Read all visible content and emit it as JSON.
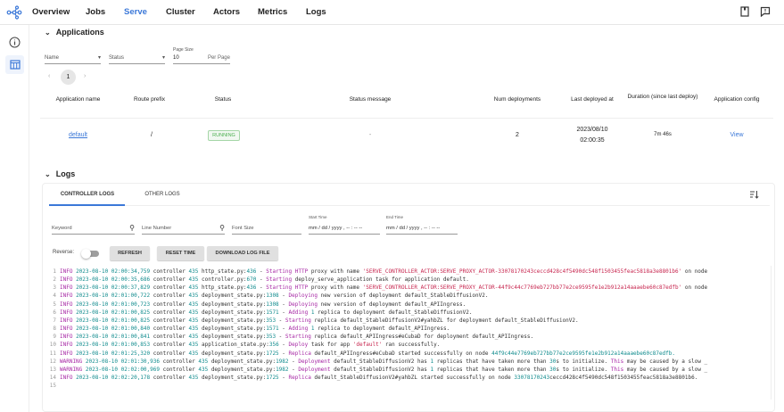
{
  "nav": {
    "items": [
      "Overview",
      "Jobs",
      "Serve",
      "Cluster",
      "Actors",
      "Metrics",
      "Logs"
    ],
    "active": "Serve"
  },
  "applications": {
    "title": "Applications",
    "filters": {
      "name": "Name",
      "status": "Status",
      "page_size_label": "Page Size",
      "page_size": "10",
      "per_page": "Per Page"
    },
    "page": "1",
    "columns": [
      "Application name",
      "Route prefix",
      "Status",
      "Status message",
      "Num deployments",
      "Last deployed at",
      "Duration (since last deploy)",
      "Application config"
    ],
    "rows": [
      {
        "name": "default",
        "route": "/",
        "status": "RUNNING",
        "message": "-",
        "num": "2",
        "deployed_date": "2023/08/10",
        "deployed_time": "02:00:35",
        "duration": "7m 46s",
        "config": "View"
      }
    ]
  },
  "logs": {
    "title": "Logs",
    "tabs": [
      "CONTROLLER LOGS",
      "OTHER LOGS"
    ],
    "keyword": "Keyword",
    "line_number": "Line Number",
    "font_size": "Font Size",
    "start_label": "Start Time",
    "end_label": "End Time",
    "start": "mm / dd / yyyy , -- : -- --",
    "end": "mm / dd / yyyy , -- : -- --",
    "reverse": "Reverse:",
    "refresh": "REFRESH",
    "reset": "RESET TIME",
    "download": "DOWNLOAD LOG FILE",
    "lines": [
      [
        [
          "k",
          "INFO"
        ],
        [
          "n",
          " 2023-08-10 02:00:34,759"
        ],
        [
          "p",
          " controller "
        ],
        [
          "n",
          "435"
        ],
        [
          "p",
          " http_state.py:"
        ],
        [
          "n",
          "436"
        ],
        [
          "p",
          " - "
        ],
        [
          "k",
          "Starting HTTP"
        ],
        [
          "p",
          " proxy with name "
        ],
        [
          "s",
          "'SERVE_CONTROLLER_ACTOR:SERVE_PROXY_ACTOR-33078170243ceccd428c4f5490dc548f1503455feac5818a3e8801b6'"
        ],
        [
          "p",
          " on node"
        ]
      ],
      [
        [
          "k",
          "INFO"
        ],
        [
          "n",
          " 2023-08-10 02:00:35,686"
        ],
        [
          "p",
          " controller "
        ],
        [
          "n",
          "435"
        ],
        [
          "p",
          " controller.py:"
        ],
        [
          "n",
          "670"
        ],
        [
          "p",
          " - "
        ],
        [
          "k",
          "Starting"
        ],
        [
          "p",
          " deploy_serve_application task for application default."
        ]
      ],
      [
        [
          "k",
          "INFO"
        ],
        [
          "n",
          " 2023-08-10 02:00:37,829"
        ],
        [
          "p",
          " controller "
        ],
        [
          "n",
          "435"
        ],
        [
          "p",
          " http_state.py:"
        ],
        [
          "n",
          "436"
        ],
        [
          "p",
          " - "
        ],
        [
          "k",
          "Starting HTTP"
        ],
        [
          "p",
          " proxy with name "
        ],
        [
          "s",
          "'SERVE_CONTROLLER_ACTOR:SERVE_PROXY_ACTOR-44f9c44c7769eb727bb77e2ce9595fe1e2b912a14aaaebe60c87edfb'"
        ],
        [
          "p",
          " on node"
        ]
      ],
      [
        [
          "k",
          "INFO"
        ],
        [
          "n",
          " 2023-08-10 02:01:00,722"
        ],
        [
          "p",
          " controller "
        ],
        [
          "n",
          "435"
        ],
        [
          "p",
          " deployment_state.py:"
        ],
        [
          "n",
          "1308"
        ],
        [
          "p",
          " - "
        ],
        [
          "k",
          "Deploying"
        ],
        [
          "p",
          " new version of deployment default_StableDiffusionV2."
        ]
      ],
      [
        [
          "k",
          "INFO"
        ],
        [
          "n",
          " 2023-08-10 02:01:00,723"
        ],
        [
          "p",
          " controller "
        ],
        [
          "n",
          "435"
        ],
        [
          "p",
          " deployment_state.py:"
        ],
        [
          "n",
          "1308"
        ],
        [
          "p",
          " - "
        ],
        [
          "k",
          "Deploying"
        ],
        [
          "p",
          " new version of deployment default_APIIngress."
        ]
      ],
      [
        [
          "k",
          "INFO"
        ],
        [
          "n",
          " 2023-08-10 02:01:00,825"
        ],
        [
          "p",
          " controller "
        ],
        [
          "n",
          "435"
        ],
        [
          "p",
          " deployment_state.py:"
        ],
        [
          "n",
          "1571"
        ],
        [
          "p",
          " - "
        ],
        [
          "k",
          "Adding"
        ],
        [
          "p",
          " "
        ],
        [
          "n",
          "1"
        ],
        [
          "p",
          " replica to deployment default_StableDiffusionV2."
        ]
      ],
      [
        [
          "k",
          "INFO"
        ],
        [
          "n",
          " 2023-08-10 02:01:00,825"
        ],
        [
          "p",
          " controller "
        ],
        [
          "n",
          "435"
        ],
        [
          "p",
          " deployment_state.py:"
        ],
        [
          "n",
          "353"
        ],
        [
          "p",
          " - "
        ],
        [
          "k",
          "Starting"
        ],
        [
          "p",
          " replica default_StableDiffusionV2#yahbZL for deployment default_StableDiffusionV2."
        ]
      ],
      [
        [
          "k",
          "INFO"
        ],
        [
          "n",
          " 2023-08-10 02:01:00,840"
        ],
        [
          "p",
          " controller "
        ],
        [
          "n",
          "435"
        ],
        [
          "p",
          " deployment_state.py:"
        ],
        [
          "n",
          "1571"
        ],
        [
          "p",
          " - "
        ],
        [
          "k",
          "Adding"
        ],
        [
          "p",
          " "
        ],
        [
          "n",
          "1"
        ],
        [
          "p",
          " replica to deployment default_APIIngress."
        ]
      ],
      [
        [
          "k",
          "INFO"
        ],
        [
          "n",
          " 2023-08-10 02:01:00,841"
        ],
        [
          "p",
          " controller "
        ],
        [
          "n",
          "435"
        ],
        [
          "p",
          " deployment_state.py:"
        ],
        [
          "n",
          "353"
        ],
        [
          "p",
          " - "
        ],
        [
          "k",
          "Starting"
        ],
        [
          "p",
          " replica default_APIIngress#eCubaD for deployment default_APIIngress."
        ]
      ],
      [
        [
          "k",
          "INFO"
        ],
        [
          "n",
          " 2023-08-10 02:01:00,853"
        ],
        [
          "p",
          " controller "
        ],
        [
          "n",
          "435"
        ],
        [
          "p",
          " application_state.py:"
        ],
        [
          "n",
          "356"
        ],
        [
          "p",
          " - "
        ],
        [
          "k",
          "Deploy"
        ],
        [
          "p",
          " task for app "
        ],
        [
          "s",
          "'default'"
        ],
        [
          "p",
          " ran successfully."
        ]
      ],
      [
        [
          "k",
          "INFO"
        ],
        [
          "n",
          " 2023-08-10 02:01:25,320"
        ],
        [
          "p",
          " controller "
        ],
        [
          "n",
          "435"
        ],
        [
          "p",
          " deployment_state.py:"
        ],
        [
          "n",
          "1725"
        ],
        [
          "p",
          " - "
        ],
        [
          "k",
          "Replica"
        ],
        [
          "p",
          " default_APIIngress#eCubaD started successfully on node "
        ],
        [
          "n",
          "44f9c44e7769eb727bb77e2ce9595fe1e2b912a14aaaebe60c87edfb."
        ]
      ],
      [
        [
          "k",
          "WARNING"
        ],
        [
          "n",
          " 2023-08-10 02:01:30,936"
        ],
        [
          "p",
          " controller "
        ],
        [
          "n",
          "435"
        ],
        [
          "p",
          " deployment_state.py:"
        ],
        [
          "n",
          "1982"
        ],
        [
          "p",
          " - "
        ],
        [
          "k",
          "Deployment"
        ],
        [
          "p",
          " default_StableDiffusionV2 has "
        ],
        [
          "n",
          "1"
        ],
        [
          "p",
          " replicas that have taken more than "
        ],
        [
          "n",
          "30"
        ],
        [
          "p",
          "s to initialize. "
        ],
        [
          "k",
          "This"
        ],
        [
          "p",
          " may be caused by a slow _"
        ]
      ],
      [
        [
          "k",
          "WARNING"
        ],
        [
          "n",
          " 2023-08-10 02:02:00,969"
        ],
        [
          "p",
          " controller "
        ],
        [
          "n",
          "435"
        ],
        [
          "p",
          " deployment_state.py:"
        ],
        [
          "n",
          "1982"
        ],
        [
          "p",
          " - "
        ],
        [
          "k",
          "Deployment"
        ],
        [
          "p",
          " default_StableDiffusionV2 has "
        ],
        [
          "n",
          "1"
        ],
        [
          "p",
          " replicas that have taken more than "
        ],
        [
          "n",
          "30"
        ],
        [
          "p",
          "s to initialize. "
        ],
        [
          "k",
          "This"
        ],
        [
          "p",
          " may be caused by a slow _"
        ]
      ],
      [
        [
          "k",
          "INFO"
        ],
        [
          "n",
          " 2023-08-10 02:02:20,178"
        ],
        [
          "p",
          " controller "
        ],
        [
          "n",
          "435"
        ],
        [
          "p",
          " deployment_state.py:"
        ],
        [
          "n",
          "1725"
        ],
        [
          "p",
          " - "
        ],
        [
          "k",
          "Replica"
        ],
        [
          "p",
          " default_StableDiffusionV2#yahbZL started successfully on node "
        ],
        [
          "n",
          "33078170243"
        ],
        [
          "p",
          "ceccd428c4f5490dc548f1503455feac5818a3e8801b6."
        ]
      ],
      []
    ]
  },
  "colors": {
    "accent": "#3b78d8",
    "running": "#4caf50"
  }
}
